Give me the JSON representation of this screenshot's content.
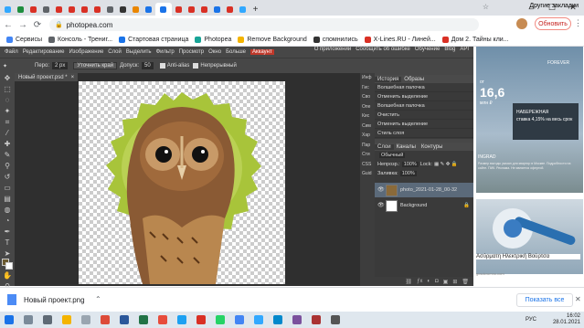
{
  "browser": {
    "tabs": [
      {
        "label": "Ph",
        "color": "#31a8ff"
      },
      {
        "label": "Б",
        "color": "#1e8e3e"
      },
      {
        "label": "Б",
        "color": "#d93025"
      },
      {
        "label": "I",
        "color": "#5f6368"
      },
      {
        "label": "Ж",
        "color": "#d93025"
      },
      {
        "label": "Ж",
        "color": "#d93025"
      },
      {
        "label": "Ж",
        "color": "#d93025"
      },
      {
        "label": "Ж",
        "color": "#d93025"
      },
      {
        "label": "6С",
        "color": "#5f6368"
      },
      {
        "label": "Г",
        "color": "#333333"
      },
      {
        "label": "Б",
        "color": "#ea8600"
      },
      {
        "label": "Б",
        "color": "#1a73e8"
      },
      {
        "label": "Ф",
        "color": "#1a73e8"
      },
      {
        "label": "Ph",
        "color": "#d93025"
      },
      {
        "label": "В",
        "color": "#d93025"
      },
      {
        "label": "Ж",
        "color": "#d93025"
      },
      {
        "label": "Ф",
        "color": "#1a73e8"
      },
      {
        "label": "П",
        "color": "#d93025"
      },
      {
        "label": "Ph",
        "color": "#31a8ff"
      }
    ],
    "new_tab": "+",
    "url": "photopea.com",
    "update_label": "Обновить",
    "bookmarks": [
      {
        "label": "Сервисы",
        "color": "#4285f4"
      },
      {
        "label": "Консоль - Трениг...",
        "color": "#5f6368"
      },
      {
        "label": "Стартовая страница",
        "color": "#1a73e8"
      },
      {
        "label": "Photopea",
        "color": "#18a497"
      },
      {
        "label": "Remove Background",
        "color": "#f4b400"
      },
      {
        "label": "спомнились",
        "color": "#333333"
      },
      {
        "label": "X-Lines.RU - Линей...",
        "color": "#d93025"
      },
      {
        "label": "Дом 2. Тайны кли...",
        "color": "#d93025"
      }
    ],
    "other_bookmarks": "Другие закладки"
  },
  "photopea": {
    "menu": [
      "Файл",
      "Редактирование",
      "Изображение",
      "Слой",
      "Выделить",
      "Фильтр",
      "Просмотр",
      "Окно",
      "Больше"
    ],
    "menu_account": "Аккаунт",
    "menu_right": [
      "О приложении",
      "Сообщить об ошибке",
      "Обучение",
      "Blog",
      "API"
    ],
    "options": {
      "feather_label": "Перо:",
      "feather_value": "2 px",
      "refine_button": "Уточнить край",
      "tolerance_label": "Допуск:",
      "tolerance_value": "50",
      "antialias": "Anti-alias",
      "contiguous": "Непрерывный"
    },
    "doc_tab": "Новый проект.psd *",
    "panel_strip": [
      "Инф",
      "Гис",
      "Сво",
      "Опе",
      "Кис",
      "Сим",
      "Хар",
      "Пар",
      "Сти",
      "CSS",
      "Guid"
    ],
    "history": {
      "tab1": "История",
      "tab2": "Образы",
      "items": [
        "Волшебная палочка",
        "Отменить выделение",
        "Волшебная палочка",
        "Очистить",
        "Отменить выделение",
        "Стиль слоя"
      ]
    },
    "layers": {
      "tabs": [
        "Слои",
        "Каналы",
        "Контуры"
      ],
      "blend_mode": "Обычный",
      "opacity_label": "Непрозр.:",
      "opacity_value": "100%",
      "lock_label": "Lock:",
      "fill_label": "Заливка:",
      "fill_value": "100%",
      "items": [
        "photo_2021-01-28_00-32",
        "Background"
      ]
    }
  },
  "ads": {
    "ad1_logo": "FOREVER",
    "ad1_price_from": "от",
    "ad1_price": "16,6",
    "ad1_price_unit": "млн ₽",
    "ad1_banner_line1": "НАБЕРЕЖНАЯ",
    "ad1_banner_line2": "ставка 4,15% на весь срок",
    "ad1_brand": "INGRAD",
    "ad1_small": "Размер выгоды указан для квартир в Москве. Подробности на сайте. ПИК. Реклама. Не является офертой.",
    "ad2_title": "Ασύρματη Ηλεκτρική Βούρτσα",
    "ad2_url": "gosdcrumno.com"
  },
  "download_bar": {
    "file_name": "Новый проект.png",
    "show_all": "Показать все"
  },
  "taskbar": {
    "lang": "РУС",
    "time": "16:02",
    "date": "28.01.2021"
  }
}
